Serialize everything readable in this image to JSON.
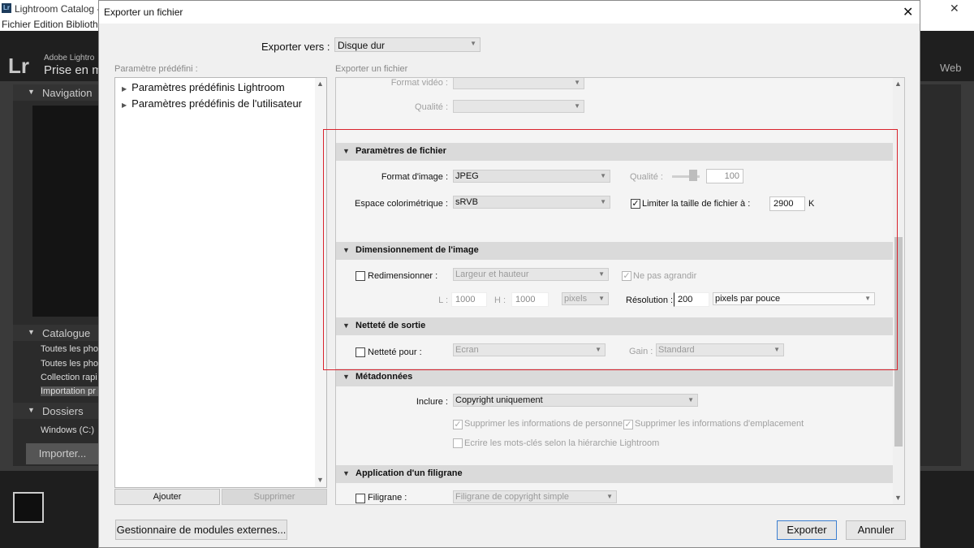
{
  "background": {
    "window_title": "Lightroom Catalog -",
    "menu": "Fichier  Edition  Bibliothè",
    "logo_short": "Lr",
    "adobe_label": "Adobe Lightro",
    "module_title": "Prise en m",
    "web_label": "Web",
    "navigator_label": "Navigation",
    "catalog_label": "Catalogue",
    "catalog_items": [
      "Toutes les pho",
      "Toutes les pho",
      "Collection rapi",
      "Importation pr"
    ],
    "folders_label": "Dossiers",
    "volume_label": "Windows (C:)",
    "import_button": "Importer..."
  },
  "dialog": {
    "title": "Exporter un fichier",
    "export_to": {
      "label": "Exporter vers :",
      "value": "Disque dur"
    },
    "presets": {
      "label": "Paramètre prédéfini :",
      "items": [
        "Paramètres prédéfinis Lightroom",
        "Paramètres prédéfinis de l'utilisateur"
      ],
      "add_button": "Ajouter",
      "remove_button": "Supprimer"
    },
    "settings": {
      "label": "Exporter un fichier",
      "video": {
        "format_label": "Format vidéo :",
        "quality_label": "Qualité :"
      },
      "file_settings": {
        "header": "Paramètres de fichier",
        "format_label": "Format d'image :",
        "format_value": "JPEG",
        "quality_label": "Qualité :",
        "quality_value": "100",
        "colorspace_label": "Espace colorimétrique :",
        "colorspace_value": "sRVB",
        "limit_checked": true,
        "limit_label": "Limiter la taille de fichier à :",
        "limit_value": "2900",
        "limit_unit": "K"
      },
      "sizing": {
        "header": "Dimensionnement de l'image",
        "resize_checked": false,
        "resize_label": "Redimensionner :",
        "resize_value": "Largeur et hauteur",
        "no_enlarge_checked": true,
        "no_enlarge_label": "Ne pas agrandir",
        "w_label": "L :",
        "w_value": "1000",
        "h_label": "H :",
        "h_value": "1000",
        "unit_value": "pixels",
        "resolution_label": "Résolution :",
        "resolution_value": "200",
        "resolution_unit": "pixels par pouce"
      },
      "sharpening": {
        "header": "Netteté de sortie",
        "checked": false,
        "label": "Netteté pour :",
        "value": "Ecran",
        "gain_label": "Gain :",
        "gain_value": "Standard"
      },
      "metadata": {
        "header": "Métadonnées",
        "include_label": "Inclure :",
        "include_value": "Copyright uniquement",
        "remove_person_label": "Supprimer les informations de personne",
        "remove_location_label": "Supprimer les informations d'emplacement",
        "hierarchy_label": "Ecrire les mots-clés selon la hiérarchie Lightroom"
      },
      "watermark": {
        "header": "Application d'un filigrane",
        "label": "Filigrane :",
        "value": "Filigrane de copyright simple"
      }
    },
    "plugin_button": "Gestionnaire de modules externes...",
    "export_button": "Exporter",
    "cancel_button": "Annuler"
  }
}
